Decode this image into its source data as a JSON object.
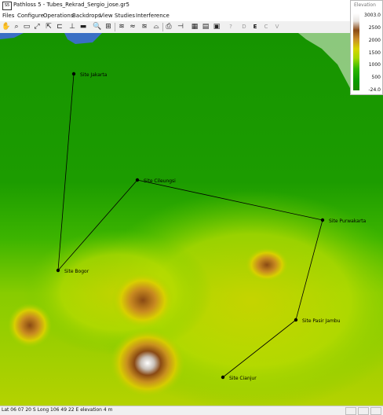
{
  "window": {
    "app_icon_text": "S5",
    "title": "Pathloss 5 - Tubes_Rekrad_Sergio_jose.gr5"
  },
  "menu": [
    "Files",
    "Configure",
    "Operations",
    "Backdrops",
    "View",
    "Studies",
    "Interference"
  ],
  "toolbar": {
    "icons": [
      "hand-icon",
      "zoom-icon",
      "select-rect-icon",
      "pan-icon",
      "fit-icon",
      "measure-icon",
      "profile-icon",
      "ruler-icon",
      "camera-icon",
      "search-icon",
      "grid-icon",
      "link-icon",
      "terrain-icon",
      "layers-icon",
      "export-icon",
      "print-icon",
      "antenna-icon",
      "table-icon",
      "report-icon",
      "settings-icon",
      "help-icon"
    ],
    "letters": [
      "D",
      "E",
      "C",
      "V"
    ],
    "active_letter": "E"
  },
  "elevation_legend": {
    "title": "Elevation",
    "ticks": [
      "3003.0",
      "2500",
      "2000",
      "1500",
      "1000",
      "500",
      "-24.0"
    ]
  },
  "sites": [
    {
      "name": "Site Jakarta"
    },
    {
      "name": "Site Cileungsi"
    },
    {
      "name": "Site Purwakarta"
    },
    {
      "name": "Site Bogor"
    },
    {
      "name": "Site Pasir Jambu"
    },
    {
      "name": "Site Cianjur"
    }
  ],
  "links": [
    [
      "Site Jakarta",
      "Site Bogor"
    ],
    [
      "Site Bogor",
      "Site Cileungsi"
    ],
    [
      "Site Cileungsi",
      "Site Purwakarta"
    ],
    [
      "Site Purwakarta",
      "Site Pasir Jambu"
    ],
    [
      "Site Pasir Jambu",
      "Site Cianjur"
    ]
  ],
  "status": {
    "text": "Lat 06 07 20 S  Long 106 49 22 E  elevation 4 m"
  },
  "colors": {
    "sea": "#3a6fc4",
    "lowland": "#1a9a00",
    "hills": "#c8d400",
    "mountain": "#8a4a14",
    "peak": "#ffffff"
  }
}
